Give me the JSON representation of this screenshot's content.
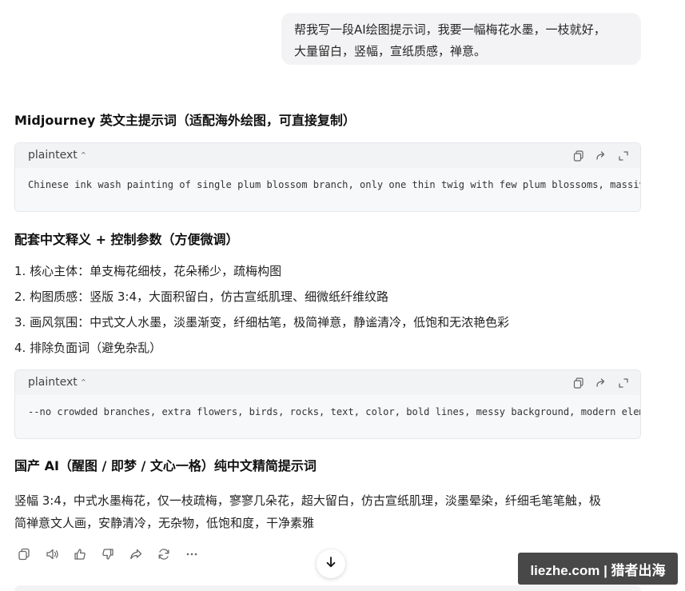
{
  "user_message": {
    "line1": "帮我写一段AI绘图提示词，我要一幅梅花水墨，一枝就好，",
    "line2": "大量留白，竖幅，宣纸质感，禅意。"
  },
  "section1": {
    "heading": "Midjourney 英文主提示词（适配海外绘图，可直接复制）",
    "code": {
      "lang": "plaintext",
      "text": "Chinese ink wash painting of single plum blossom branch, only one thin twig with few plum blossoms, massive"
    }
  },
  "section2": {
    "heading": "配套中文释义 + 控制参数（方便微调）",
    "items": [
      "1. 核心主体：单支梅花细枝，花朵稀少，疏梅构图",
      "2. 构图质感：竖版 3:4，大面积留白，仿古宣纸肌理、细微纸纤维纹路",
      "3. 画风氛围：中式文人水墨，淡墨渐变，纤细枯笔，极简禅意，静谧清冷，低饱和无浓艳色彩",
      "4. 排除负面词（避免杂乱）"
    ],
    "code": {
      "lang": "plaintext",
      "text": "--no crowded branches, extra flowers, birds, rocks, text, color, bold lines, messy background, modern elements"
    }
  },
  "section3": {
    "heading": "国产 AI（醒图 / 即梦 / 文心一格）纯中文精简提示词",
    "line1": "竖幅 3:4，中式水墨梅花，仅一枝疏梅，寥寥几朵花，超大留白，仿古宣纸肌理，淡墨晕染，纤细毛笔笔触，极",
    "line2": "简禅意文人画，安静清冷，无杂物，低饱和度，干净素雅"
  },
  "action_icons": [
    "copy-icon",
    "speaker-icon",
    "thumbs-up-icon",
    "thumbs-down-icon",
    "share-icon",
    "regenerate-icon",
    "more-icon"
  ],
  "code_action_icons": [
    "copy-icon",
    "share-arrow-icon",
    "expand-icon"
  ],
  "watermark": {
    "text": "liezhe.com | 猎者出海"
  },
  "colors": {
    "bubble_bg": "#f3f3f5",
    "code_bg": "#f7f8fa",
    "code_header_bg": "#f2f3f5",
    "icon": "#666666"
  }
}
